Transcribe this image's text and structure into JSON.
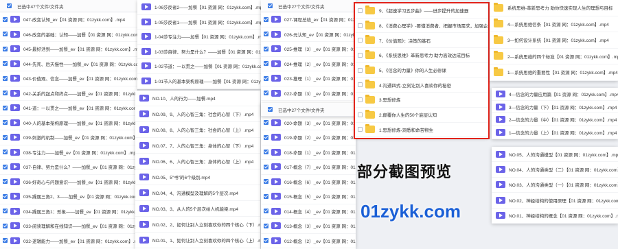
{
  "panel_a": {
    "header": "已选中47个文件/文件夹",
    "rows": [
      "047-改变认知_ev【01 资源 网：01zykk.com】.mp4",
      "046-改变的基础：认知——加餐【01 资源 网：01zykk.com】.mp4",
      "045-最好活到——加餐_ev【01 资源 网：01zykk.com】.mp4",
      "044-先死、后天慢性——加餐_ev【01 资源 网：01zykk.com】.mp4",
      "043-价值观、信念——加餐_ev【01 资源 网：01zykk.com】.mp4",
      "042-关系的起点和终点——加餐_ev【01 资源 网：01zykk.com】.mp4",
      "041-道：一以贯之——加餐_ev【01 资源 网：01zykk.com】.mp4",
      "040-人的基本架构原理——加餐_ev【01 资源 网：01zykk.com】.mp4",
      "039-刺激的机制——加餐_ev【01 资源 网：01zykk.com】.mp4",
      "038-专注力——加餐_ev【01 资源 网：01zykk.com】.mp4",
      "037-自律、努力是什么？——加餐_ev【01 资源 网：01zykk.com】.mp4",
      "036-好奇心与问题意识——加餐_ev【01 资源 网：01zykk.com】.mp4",
      "035-躁属三角2、3——加餐_ev【01 资源 网：01zykk.com】.mp4",
      "034-躁属三角1：形象——加餐_ev【01 资源 网：01zykk.com】.mp4",
      "033-阅读理解和在线知识——加餐_ev【01 资源 网：01zykk.com】.mp4",
      "032-逻辑能力——加餐_ev【01 资源 网：01zykk.com】.mp4"
    ]
  },
  "panel_b": {
    "rows": [
      "1-06莎反省2——加餐【01 资源 网：01zykk.com】.mp4",
      "1-05莎反省1——加餐【01 资源 网：01zykk.com】.mp4",
      "1-04莎专注力——加餐【01 资源 网：01zykk.com】.mp4",
      "1-03莎自律、努力是什么？——加餐【01 资源 网：01zykk.com】.mp4",
      "1-02节道：一以贯之——加餐【01 资源 网：01zykk.com】.mp4",
      "1-01节人的基本架构原理——加餐【01 资源 网：01zykk.com】.mp4"
    ]
  },
  "panel_c": {
    "rows": [
      "NO.10、人的行为——加餐.mp4",
      "NO.09、9、人的心智三角：社会的心智（下）.mp4",
      "NO.08、8、人的心智三角：社会的心智（上）.mp4",
      "NO.07、7、人的心智三角：身体的心智（下）.mp4",
      "NO.06、6、人的心智三角：身体的心智（上）.mp4",
      "NO.05、5\"书\"的6个级别.mp4",
      "NO.04、4、沟通模型及理解的5个层次.mp4",
      "NO.03、3、从人的5个层次给人机能梁.mp4",
      "NO.02、2、如何让别人立刻喜欢你的四个核心（下）.mp4",
      "NO.01、1、如何让别人立刻喜欢你的四个核心（上）.mp4"
    ]
  },
  "panel_d": {
    "header": "已选中27个文件/文件夹",
    "rows": [
      "027-课程总结_ev【01 资源 网：01zykk.com】.mp4",
      "026-元认知_ev【01 资源 网：01zykk.com】.mp4",
      "025-推理（3）_ev【01 资源 网：01zykk.com】.mp4",
      "024-推理（2）_ev【01 资源 网：01zykk.com】.mp4",
      "023-推理（1）_ev【01 资源 网：01zykk.com】.mp4",
      "022-命题（3）_ev【01 资源 网：01zykk.com】.mp4",
      "021-推论（1）_ev【01 资源 网：01zykk.com】.mp4",
      "020-命题（3）_ev【01 资源 网：01zykk.com】.mp4",
      "019-命题（2）_ev【01 资源 网：01zykk.com】.mp4",
      "018-命题（1）_ev【01 资源 网：01zykk.com】.mp4",
      "017-概念（7）_ev【01 资源 网：01zykk.com】.mp4",
      "016-概念（6）_ev【01 资源 网：01zykk.com】.mp4",
      "015-概念（5）_ev【01 资源 网：01zykk.com】.mp4",
      "014-概念（4）_ev【01 资源 网：01zykk.com】.mp4",
      "013-概念（3）_ev【01 资源 网：01zykk.com】.mp4",
      "012-概念（2）_ev【01 资源 网：01zykk.com】.mp4"
    ]
  },
  "panel_e": {
    "header": "已选中27个文件/文件夹",
    "rows": []
  },
  "panel_f": {
    "folders": [
      "9、《超速学习五步曲》——进步提升的加速器",
      "8、《消费心理学》-要懂消费者、把握市场需求，加强企业经营管理",
      "7、《价值观》：决策的基石",
      "6、《系统思维》革新思考力 助力高效达成目标",
      "5、《信念的力量》你的人生必修课",
      "4.沟通四式-立刻让别人喜欢你的秘密",
      "3.思想修炼",
      "2.颠覆你人生的50个底层认知",
      "1.思想修炼-洞悉和命苦物生"
    ]
  },
  "panel_g": {
    "rows": [
      "系统思维-革新思考力 助你快速实现人生的理想与目标",
      "4—系统思维信条【01 资源 网：01zykk.com】.mp4",
      "3—如何设计系统【01 资源 网：01zykk.com】.mp4",
      "2—系统思维的四个标准【01 资源 网：01zykk.com】.mp4",
      "1—系统思维的重要性【01 资源 网：01zykk.com】.mp4"
    ]
  },
  "panel_h": {
    "rows": [
      "4—信念的力量应用篇【01 资源 网：01zykk.com】.mp4",
      "3—信念的力量（下）【01 资源 网：01zykk.com】.mp4",
      "2—信念的力量（中）【01 资源 网：01zykk.com】.mp4",
      "1—信念的力量（上）【01 资源 网：01zykk.com】.mp4"
    ]
  },
  "panel_i": {
    "rows": [
      "NO.05、人的沟通模型【01 资源 网：01zykk.com】.mp4",
      "NO.04、人的沟通类型（二）【01 资源 网：01zykk.com】.mp4",
      "NO.03、人的沟通类型（一）【01 资源 网：01zykk.com】.mp4",
      "NO.02、神经结构的使用原理【01 资源 网：01zykk.com】.mp4",
      "NO.01、神经结构的概念【01 资源 网：01zykk.com】.mp4"
    ]
  },
  "overlay": {
    "title": "部分截图预览",
    "site": "01zykk.com"
  },
  "colors": {
    "video_icon": "#6b63e8",
    "folder_icon": "#f7c944",
    "checkbox": "#3b7ce6",
    "highlight_box": "#e2231a",
    "site_text": "#1a5fd6"
  }
}
